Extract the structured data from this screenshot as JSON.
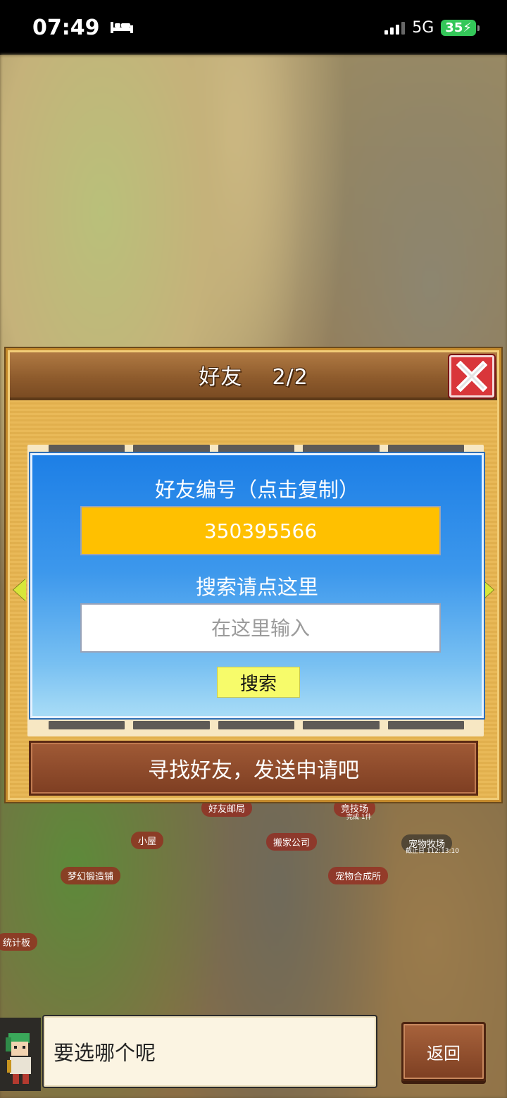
{
  "status_bar": {
    "time": "07:49",
    "network": "5G",
    "battery": "35"
  },
  "map_labels": {
    "friend_post": "好友邮局",
    "arena": "竞技场",
    "arena_sub": "完成 1件",
    "cabin": "小屋",
    "moving_company": "搬家公司",
    "pet_ranch": "宠物牧场",
    "pet_ranch_sub": "截止日 112:13:10",
    "dream_forge": "梦幻锻造铺",
    "pet_fusion": "宠物合成所",
    "stats_board": "统计板"
  },
  "dialog": {
    "title": "好友",
    "page": "2/2",
    "friend_id_label": "好友编号（点击复制）",
    "friend_id": "350395566",
    "search_label": "搜索请点这里",
    "search_placeholder": "在这里输入",
    "search_button": "搜索",
    "banner": "寻找好友，发送申请吧"
  },
  "bottom_bar": {
    "prompt": "要选哪个呢",
    "back_button": "返回"
  },
  "colors": {
    "dialog_bg": "#e8b54f",
    "header_brown": "#8f5c2d",
    "panel_blue": "#1d7fe6",
    "id_box_yellow": "#ffc000",
    "search_button_yellow": "#f7fb6a",
    "close_red": "#d9363a",
    "banner_brown": "#7e3e22"
  },
  "icons": {
    "bed": "bed-icon",
    "signal": "signal-icon",
    "battery": "battery-icon",
    "close": "close-icon",
    "left_arrow": "arrow-left-icon",
    "right_arrow": "arrow-right-icon"
  }
}
